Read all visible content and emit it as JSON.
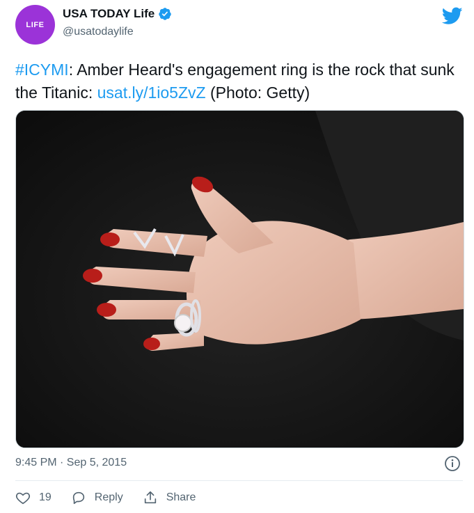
{
  "account": {
    "avatar_label": "LIFE",
    "display_name": "USA TODAY Life",
    "handle": "@usatodaylife"
  },
  "tweet": {
    "hashtag": "#ICYMI",
    "text_part1": ": Amber Heard's engagement ring is the rock that sunk the Titanic: ",
    "link": "usat.ly/1io5ZvZ",
    "text_part2": " (Photo: Getty)",
    "timestamp": "9:45 PM · Sep 5, 2015"
  },
  "actions": {
    "like_count": "19",
    "reply_label": "Reply",
    "share_label": "Share"
  },
  "colors": {
    "avatar_bg": "#9b33d8",
    "link": "#1d9bf0",
    "verified": "#1d9bf0",
    "muted": "#536471"
  },
  "icons": [
    "twitter-bird-icon",
    "verified-badge-icon",
    "info-icon",
    "heart-icon",
    "reply-icon",
    "share-icon"
  ]
}
